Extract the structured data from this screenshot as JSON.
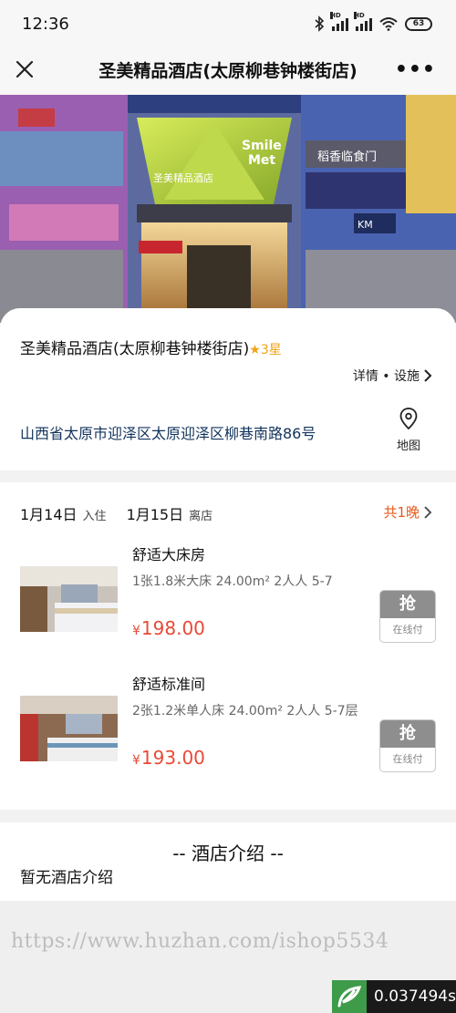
{
  "status_bar": {
    "time": "12:36",
    "battery": "63",
    "signal_label": "HD",
    "icons": [
      "bluetooth-icon",
      "signal-icon",
      "signal-icon",
      "wifi-icon",
      "battery-icon"
    ]
  },
  "nav": {
    "title": "圣美精品酒店(太原柳巷钟楼街店)",
    "more": "•••"
  },
  "hotel": {
    "name": "圣美精品酒店(太原柳巷钟楼街店)",
    "stars": "3星",
    "detail_link": "详情 • 设施",
    "address": "山西省太原市迎泽区太原迎泽区柳巷南路86号",
    "map_label": "地图",
    "hero_signs": {
      "brand_a": "Smile",
      "brand_b": "Met",
      "hotel_sign": "圣美精品酒店",
      "shop_right": "稻香临食门",
      "km": "KM"
    }
  },
  "booking": {
    "checkin_date": "1月14日",
    "checkin_label": "入住",
    "checkout_date": "1月15日",
    "checkout_label": "离店",
    "nights": "共1晚"
  },
  "rooms": [
    {
      "name": "舒适大床房",
      "desc": "1张1.8米大床   24.00m²  2人人  5-7",
      "currency": "¥",
      "price": "198.00",
      "buy_label": "抢",
      "pay_label": "在线付"
    },
    {
      "name": "舒适标准间",
      "desc": "2张1.2米单人床  24.00m²  2人人  5-7层",
      "currency": "¥",
      "price": "193.00",
      "buy_label": "抢",
      "pay_label": "在线付"
    }
  ],
  "intro": {
    "title": "-- 酒店介绍 --",
    "text": "暂无酒店介绍"
  },
  "watermark": "https://www.huzhan.com/ishop5534",
  "timer": "0.037494s",
  "colors": {
    "accent_orange": "#e85a1c",
    "price_red": "#e84a36",
    "star_gold": "#f0a21a",
    "address_blue": "#12335c"
  }
}
